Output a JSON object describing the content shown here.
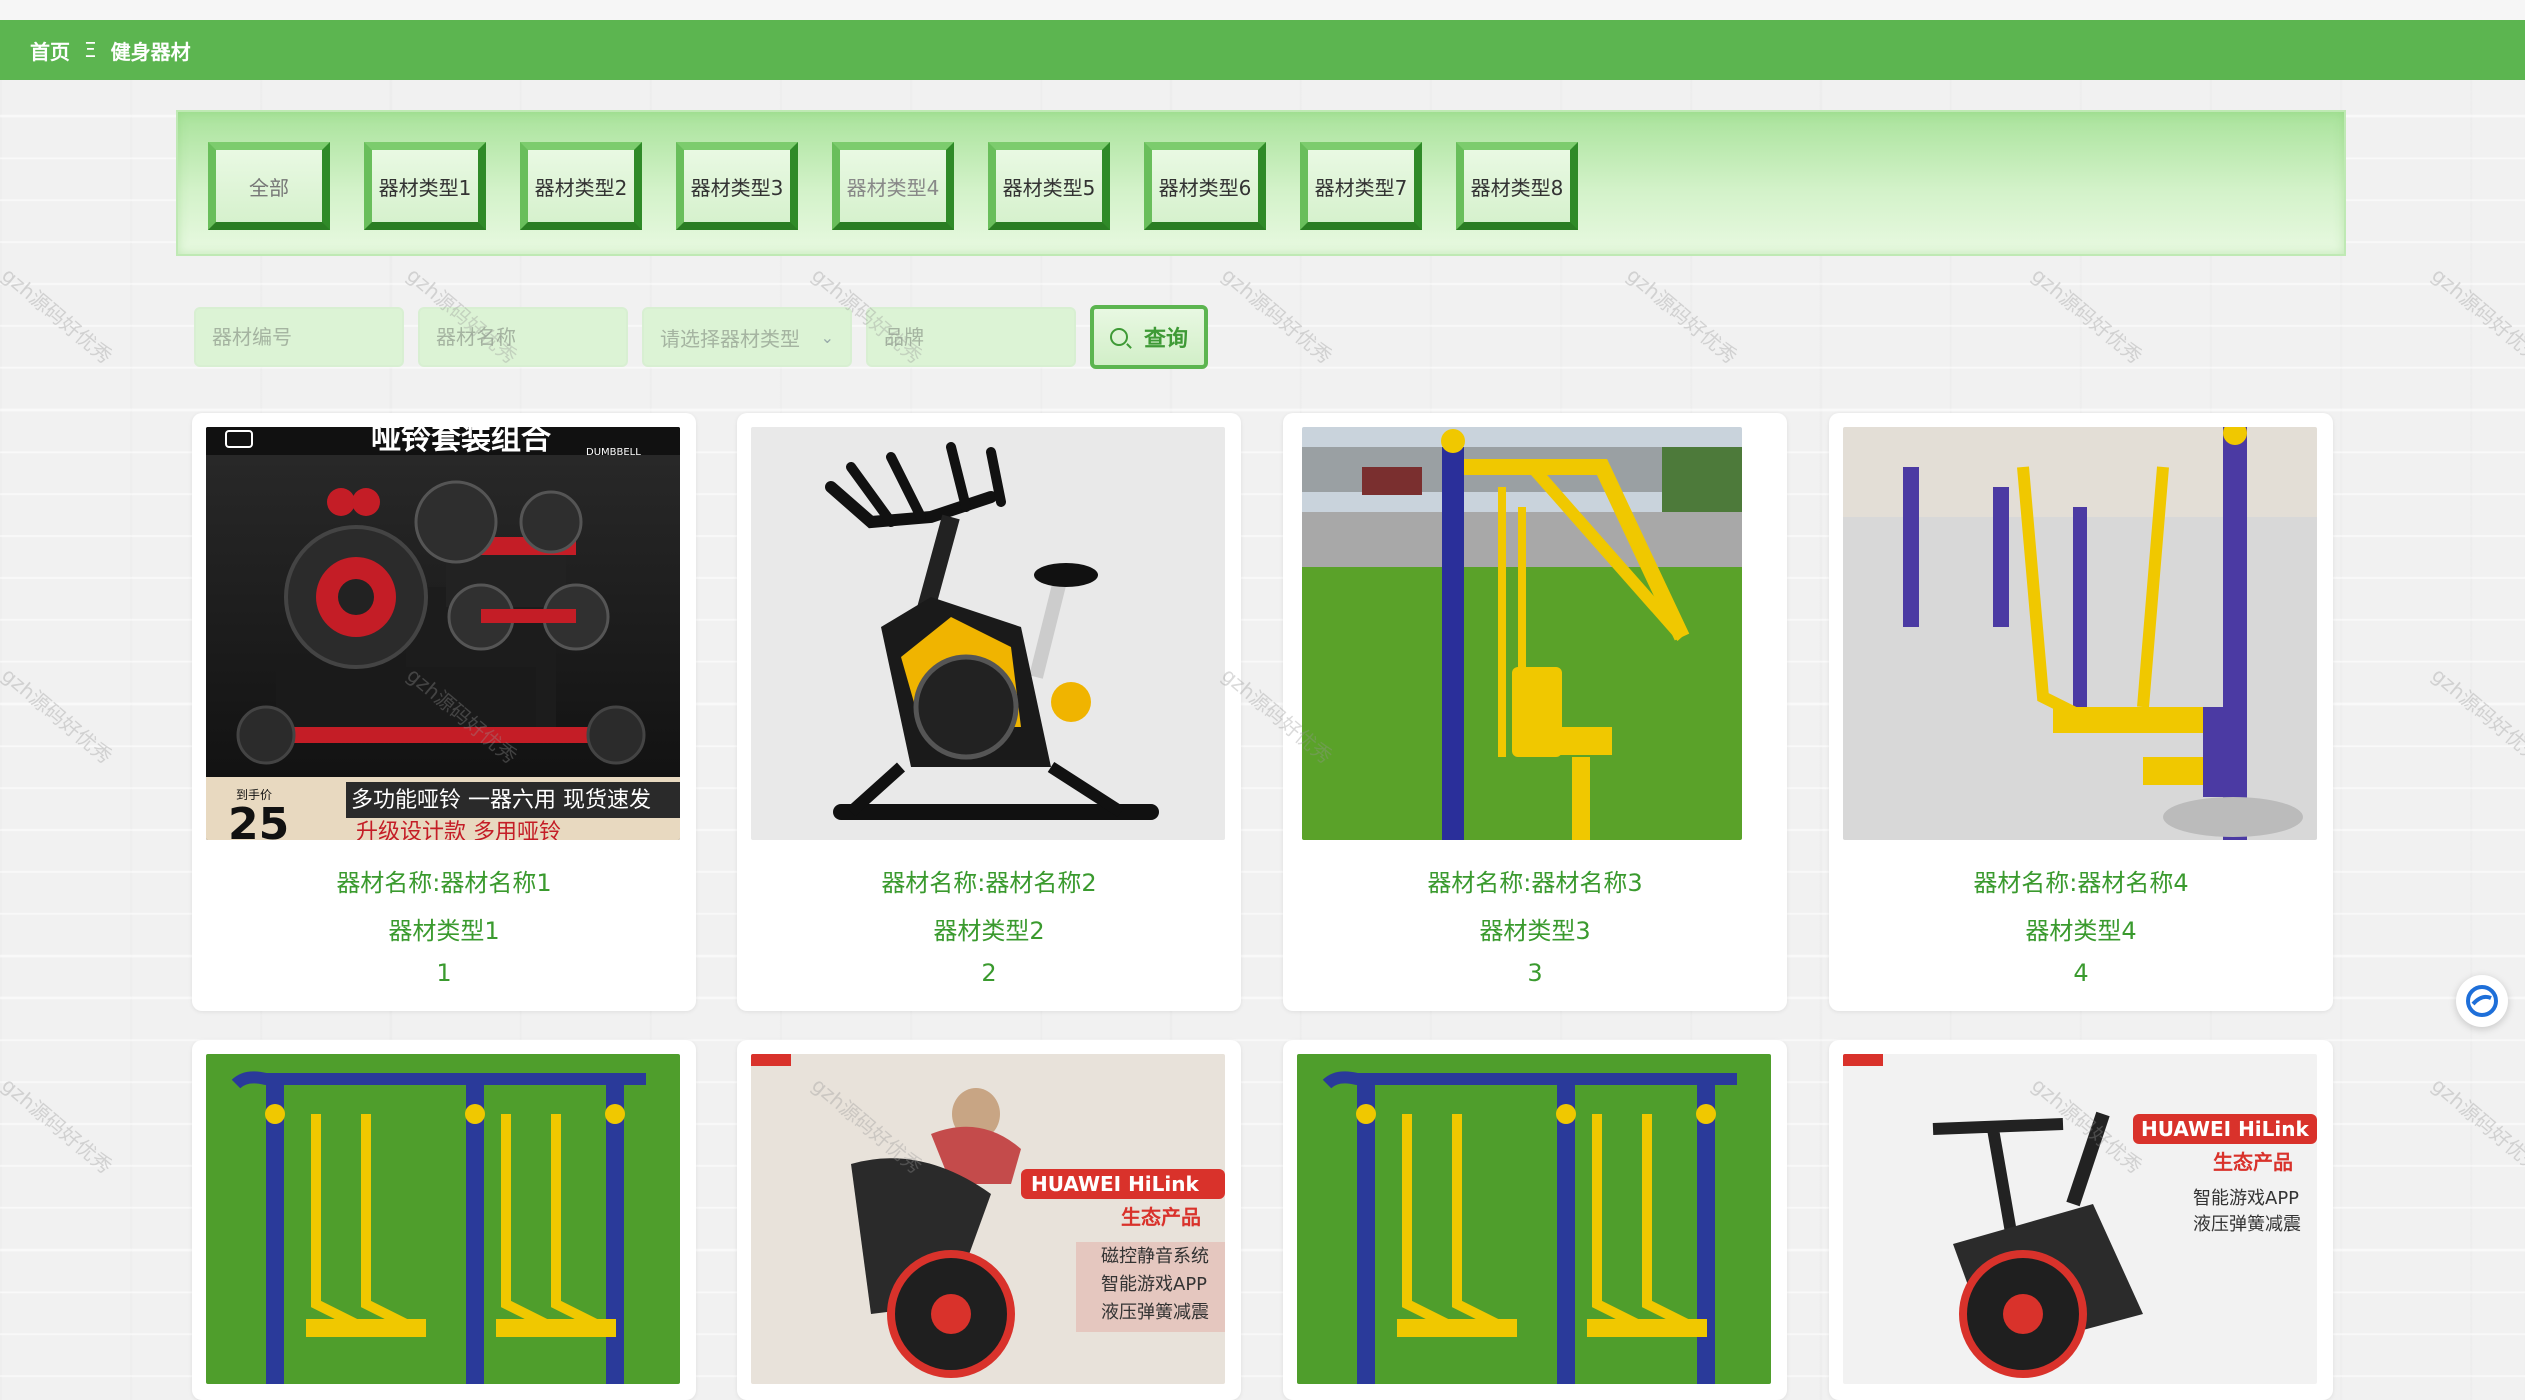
{
  "header": {
    "home": "首页",
    "separator": "Ξ",
    "page": "健身器材"
  },
  "categories": [
    "全部",
    "器材类型1",
    "器材类型2",
    "器材类型3",
    "器材类型4",
    "器材类型5",
    "器材类型6",
    "器材类型7",
    "器材类型8"
  ],
  "search": {
    "code_placeholder": "器材编号",
    "name_placeholder": "器材名称",
    "type_placeholder": "请选择器材类型",
    "brand_placeholder": "品牌",
    "query_label": "查询"
  },
  "products": [
    {
      "name": "器材名称:器材名称1",
      "type": "器材类型1",
      "num": "1",
      "img": "dumbbell",
      "caption1": "哑铃套装组合",
      "caption2": "多功能哑铃 一器六用 现货速发",
      "caption3": "升级设计款 多用哑铃",
      "price_tag": "到手价",
      "price": "25",
      "brand_mark": "DUMBBELL"
    },
    {
      "name": "器材名称:器材名称2",
      "type": "器材类型2",
      "num": "2",
      "img": "spinbike"
    },
    {
      "name": "器材名称:器材名称3",
      "type": "器材类型3",
      "num": "3",
      "img": "outdoor1"
    },
    {
      "name": "器材名称:器材名称4",
      "type": "器材类型4",
      "num": "4",
      "img": "outdoor2"
    },
    {
      "name": "",
      "type": "",
      "num": "",
      "img": "walker"
    },
    {
      "name": "",
      "type": "",
      "num": "",
      "img": "woman-bike",
      "badge": "HUAWEI HiLink",
      "sub": "生态产品",
      "features": [
        "磁控静音系统",
        "智能游戏APP",
        "液压弹簧减震"
      ]
    },
    {
      "name": "",
      "type": "",
      "num": "",
      "img": "walker"
    },
    {
      "name": "",
      "type": "",
      "num": "",
      "img": "bike-red",
      "badge": "HUAWEI HiLink",
      "sub": "生态产品",
      "features": [
        "智能游戏APP",
        "液压弹簧减震"
      ]
    }
  ],
  "watermark": "gzh源码好优秀",
  "colors": {
    "accent": "#5cb550",
    "text_green": "#3a9a2e"
  }
}
